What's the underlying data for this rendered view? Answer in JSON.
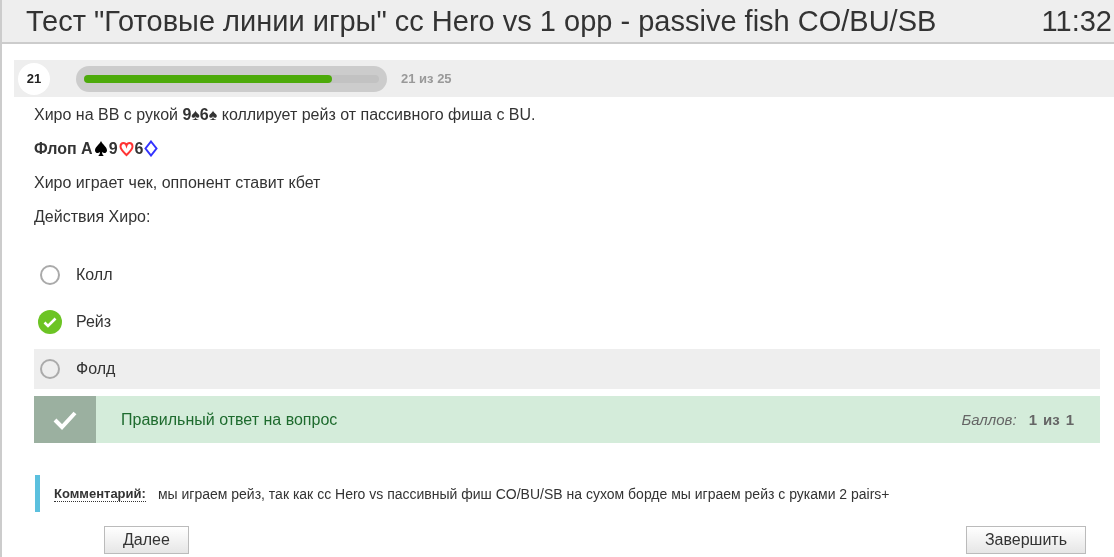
{
  "header": {
    "title": "Тест \"Готовые линии игры\" cc Hero vs 1 opp - passive fish CO/BU/SB",
    "timer": "11:32"
  },
  "progress": {
    "number": "21",
    "level": 0.84,
    "counter": "21 из 25"
  },
  "question": {
    "lines": [
      "Хиро на BB с рукой **9♠6♠** коллирует рейз от пассивного фиша с BU."
    ],
    "flop": {
      "label": "Флоп",
      "cards": [
        {
          "rank": "A",
          "kind": "spade",
          "color": "#000000"
        },
        {
          "rank": "9",
          "kind": "heart",
          "color": "#ff3333"
        },
        {
          "rank": "6",
          "kind": "diamond",
          "color": "#3333ff"
        }
      ]
    },
    "after": [
      "Хиро играет чек, оппонент ставит кбет",
      "Действия Хиро:"
    ]
  },
  "options": [
    {
      "label": "Колл",
      "selected": false,
      "hovered": false
    },
    {
      "label": "Рейз",
      "selected": true,
      "hovered": false
    },
    {
      "label": "Фолд",
      "selected": false,
      "hovered": true
    }
  ],
  "result": {
    "correct": true,
    "message": "Правильный ответ на вопрос",
    "score_label": "Баллов:",
    "score": "1",
    "of": "из",
    "max": "1"
  },
  "comment": {
    "label": "Комментарий:",
    "text": "мы играем рейз, так как cc Hero vs пассивный фиш CO/BU/SB на сухом борде мы играем рейз с руками 2 pairs+"
  },
  "buttons": [
    {
      "label": "Далее"
    },
    {
      "label": "Завершить"
    }
  ]
}
